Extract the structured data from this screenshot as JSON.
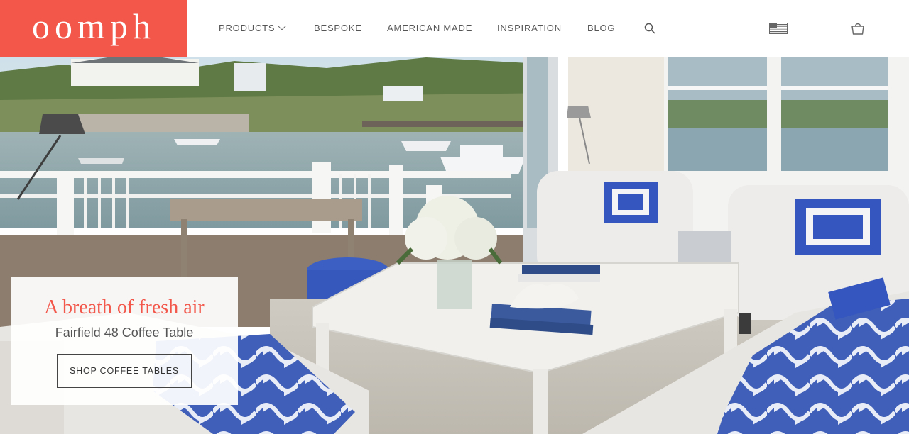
{
  "brand": {
    "logo_text": "oomph",
    "accent_color": "#f2574a"
  },
  "nav": {
    "products": "PRODUCTS",
    "bespoke": "BESPOKE",
    "american_made": "AMERICAN MADE",
    "inspiration": "INSPIRATION",
    "blog": "BLOG"
  },
  "icons": {
    "search": "search-icon",
    "flag": "us-flag-icon",
    "cart": "shopping-bag-icon",
    "products_dropdown": "chevron-down-icon"
  },
  "hero": {
    "headline": "A breath of fresh air",
    "subheadline": "Fairfield 48 Coffee Table",
    "cta_label": "SHOP COFFEE TABLES"
  }
}
